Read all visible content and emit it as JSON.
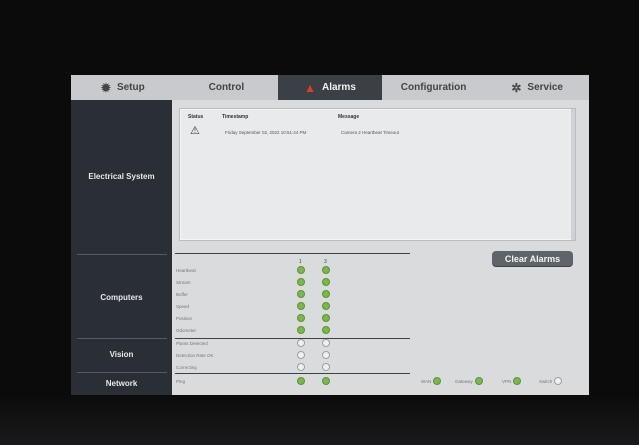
{
  "tabs": [
    {
      "label": "Setup",
      "icon": "gear-icon",
      "active": false
    },
    {
      "label": "Control",
      "icon": "",
      "active": false
    },
    {
      "label": "Alarms",
      "icon": "warning-icon",
      "active": true
    },
    {
      "label": "Configuration",
      "icon": "",
      "active": false
    },
    {
      "label": "Service",
      "icon": "wrench-gear-icon",
      "active": false
    }
  ],
  "sections": {
    "electrical": "Electrical System",
    "computers": "Computers",
    "vision": "Vision",
    "network": "Network"
  },
  "alarm_table": {
    "headers": {
      "status": "Status",
      "timestamp": "Timestamp",
      "message": "Message"
    },
    "rows": [
      {
        "status_icon": "warning-icon",
        "timestamp": "Friday September 02, 2022 10:51:44 PM",
        "message": "Camera 2 Heartbeat Timeout"
      }
    ]
  },
  "clear_button": "Clear Alarms",
  "computers": {
    "columns": [
      "1",
      "3"
    ],
    "rows": [
      {
        "label": "Heartbeat",
        "states": [
          "on",
          "on"
        ]
      },
      {
        "label": "Stream",
        "states": [
          "on",
          "on"
        ]
      },
      {
        "label": "Buffer",
        "states": [
          "on",
          "on"
        ]
      },
      {
        "label": "Speed",
        "states": [
          "on",
          "on"
        ]
      },
      {
        "label": "Position",
        "states": [
          "on",
          "on"
        ]
      },
      {
        "label": "Odometer",
        "states": [
          "on",
          "on"
        ]
      }
    ]
  },
  "vision": {
    "rows": [
      {
        "label": "Plants Detected",
        "states": [
          "off",
          "off"
        ]
      },
      {
        "label": "Detection Rate OK",
        "states": [
          "off",
          "off"
        ]
      },
      {
        "label": "Correcting",
        "states": [
          "off",
          "off"
        ]
      }
    ]
  },
  "network": {
    "rows": [
      {
        "label": "Ping",
        "states": [
          "on",
          "on"
        ]
      }
    ],
    "indicators": [
      {
        "label": "WAN",
        "state": "on"
      },
      {
        "label": "Gateway",
        "state": "on"
      },
      {
        "label": "VPN",
        "state": "on"
      },
      {
        "label": "Switch",
        "state": "off"
      }
    ]
  },
  "colors": {
    "accent_red": "#e03a2f",
    "led_green": "#79b948",
    "sidebar": "#2a2f36"
  }
}
